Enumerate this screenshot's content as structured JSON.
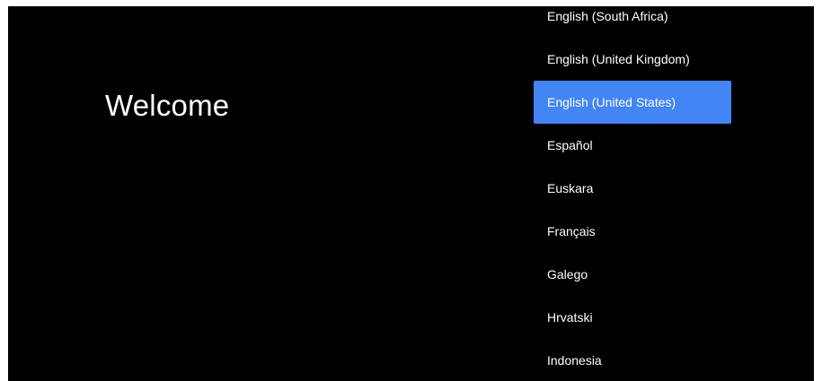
{
  "welcome": {
    "title": "Welcome"
  },
  "language_list": {
    "selected_color": "#4285f4",
    "items": [
      {
        "label": "English (South Africa)",
        "selected": false
      },
      {
        "label": "English (United Kingdom)",
        "selected": false
      },
      {
        "label": "English (United States)",
        "selected": true
      },
      {
        "label": "Español",
        "selected": false
      },
      {
        "label": "Euskara",
        "selected": false
      },
      {
        "label": "Français",
        "selected": false
      },
      {
        "label": "Galego",
        "selected": false
      },
      {
        "label": "Hrvatski",
        "selected": false
      },
      {
        "label": "Indonesia",
        "selected": false
      }
    ]
  }
}
